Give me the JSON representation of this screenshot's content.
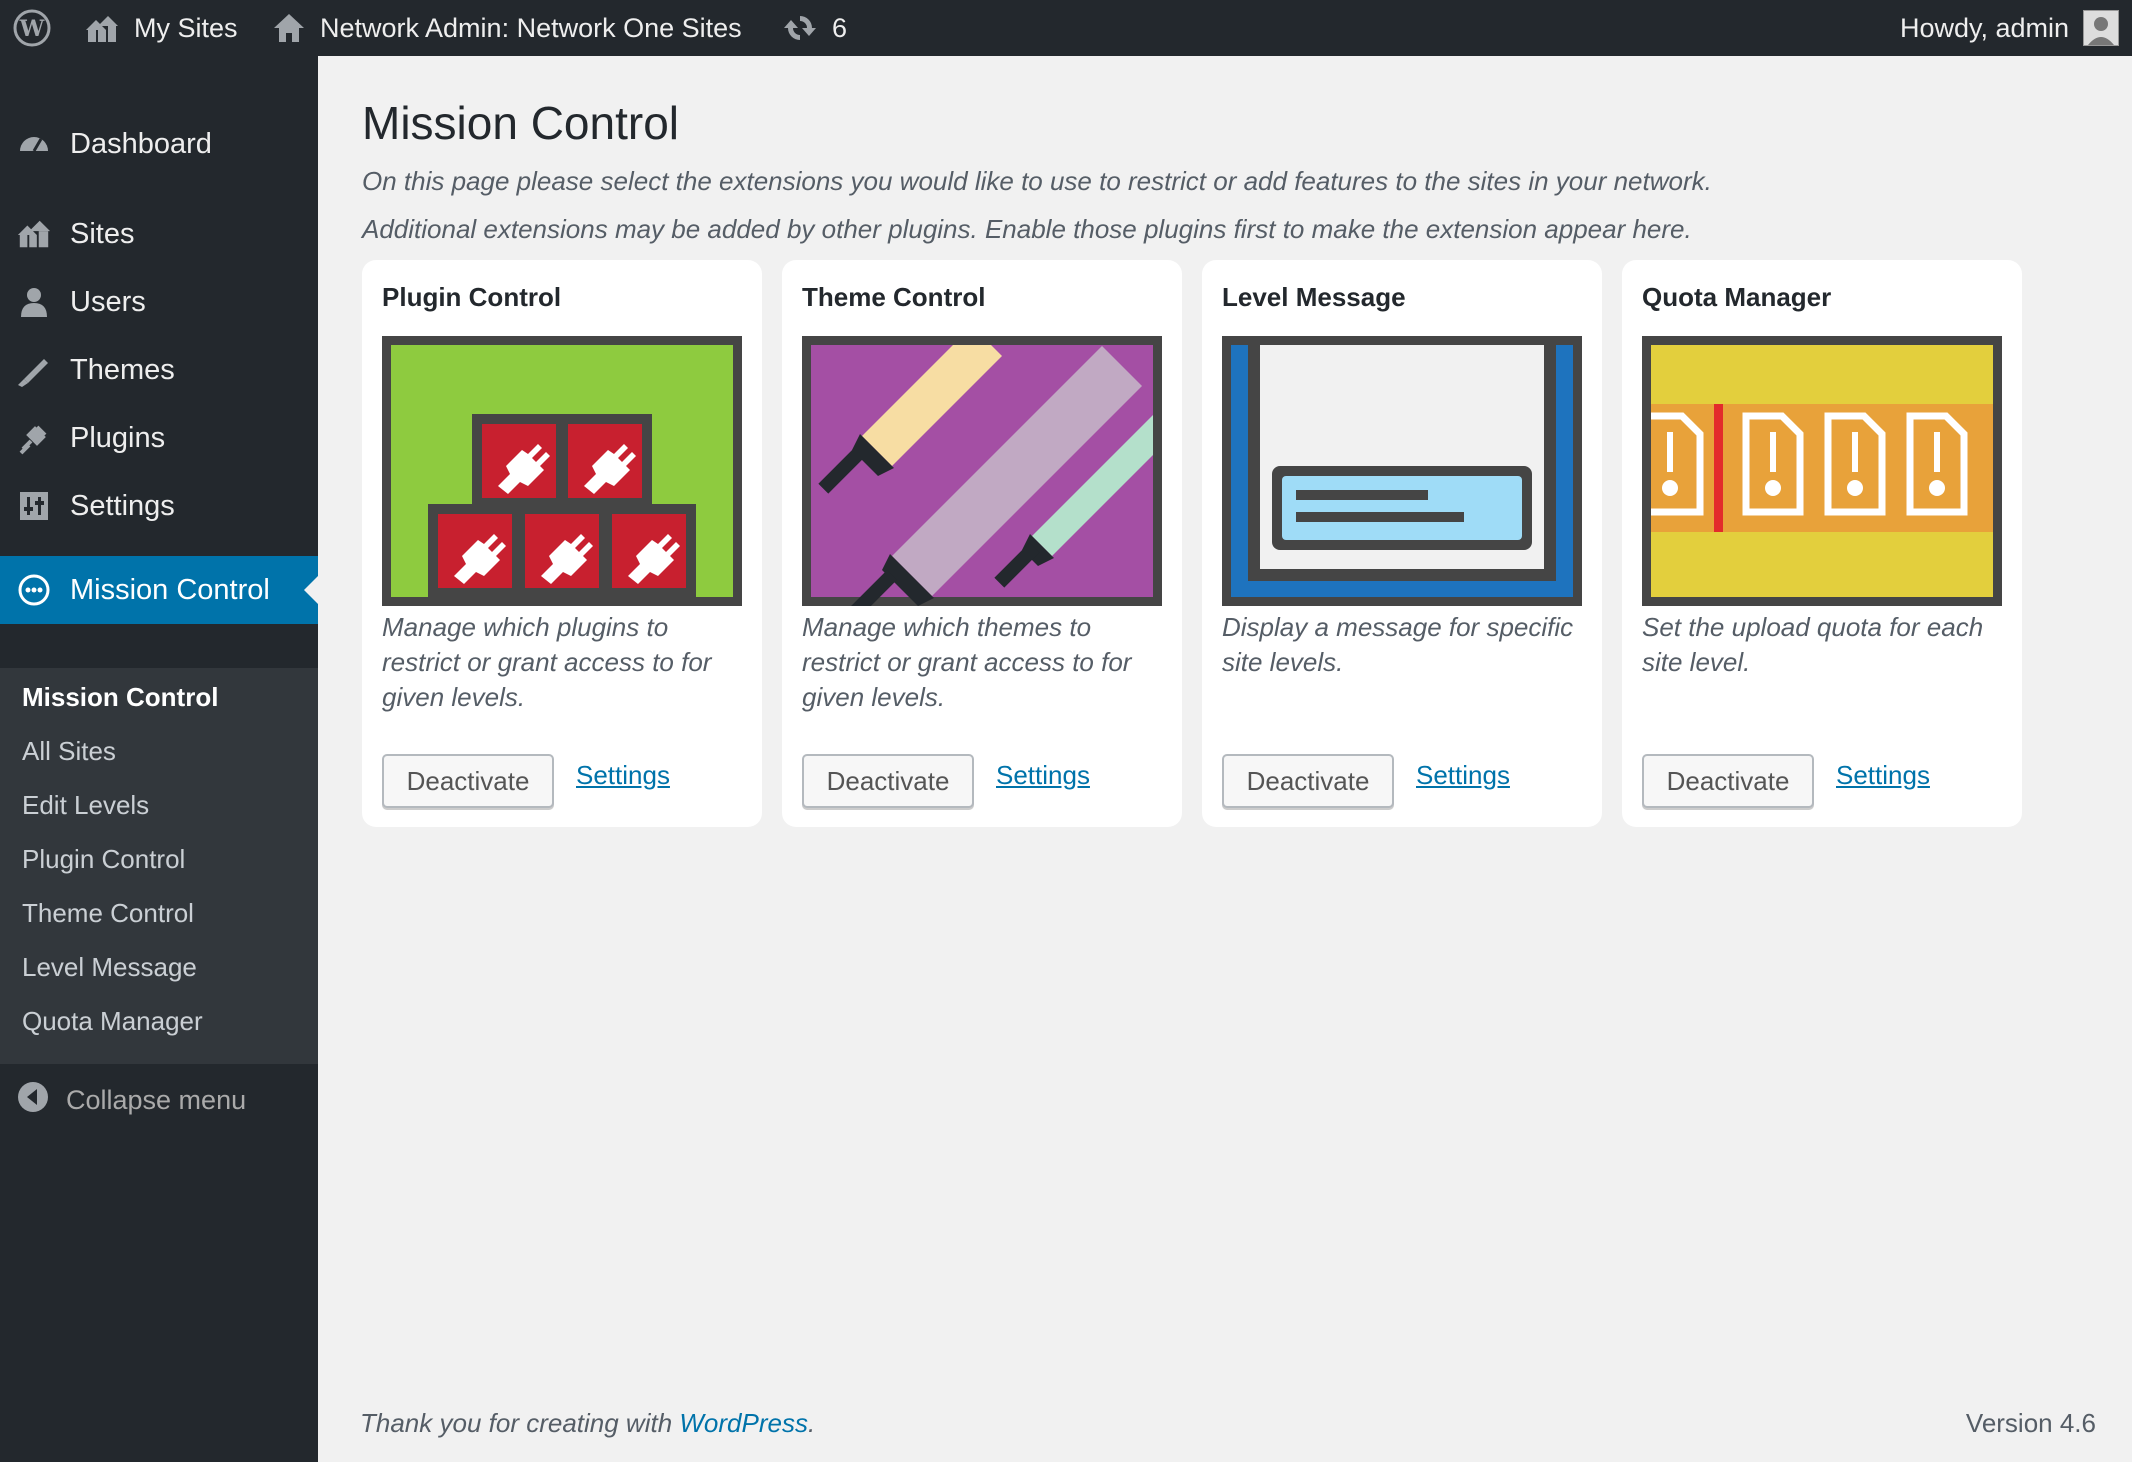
{
  "adminbar": {
    "my_sites": "My Sites",
    "network_admin": "Network Admin: Network One Sites",
    "updates_count": "6",
    "howdy": "Howdy, admin"
  },
  "sidebar": {
    "items": [
      {
        "label": "Dashboard",
        "icon": "dashboard-icon"
      },
      {
        "label": "Sites",
        "icon": "sites-icon"
      },
      {
        "label": "Users",
        "icon": "users-icon"
      },
      {
        "label": "Themes",
        "icon": "themes-icon"
      },
      {
        "label": "Plugins",
        "icon": "plugins-icon"
      },
      {
        "label": "Settings",
        "icon": "settings-icon"
      },
      {
        "label": "Mission Control",
        "icon": "mission-control-icon"
      }
    ],
    "submenu": [
      "Mission Control",
      "All Sites",
      "Edit Levels",
      "Plugin Control",
      "Theme Control",
      "Level Message",
      "Quota Manager"
    ],
    "collapse": "Collapse menu"
  },
  "page": {
    "title": "Mission Control",
    "desc1": "On this page please select the extensions you would like to use to restrict or add features to the sites in your network.",
    "desc2": "Additional extensions may be added by other plugins. Enable those plugins first to make the extension appear here."
  },
  "cards": [
    {
      "title": "Plugin Control",
      "desc": "Manage which plugins to restrict or grant access to for given levels.",
      "button": "Deactivate",
      "link": "Settings",
      "color": "#8ecb3f"
    },
    {
      "title": "Theme Control",
      "desc": "Manage which themes to restrict or grant access to for given levels.",
      "button": "Deactivate",
      "link": "Settings",
      "color": "#a44fa4"
    },
    {
      "title": "Level Message",
      "desc": "Display a message for specific site levels.",
      "button": "Deactivate",
      "link": "Settings",
      "color": "#1e73be"
    },
    {
      "title": "Quota Manager",
      "desc": "Set the upload quota for each site level.",
      "button": "Deactivate",
      "link": "Settings",
      "color": "#e3cf3d"
    }
  ],
  "footer": {
    "thanks_prefix": "Thank you for creating with ",
    "thanks_link": "WordPress",
    "thanks_suffix": ".",
    "version": "Version 4.6"
  }
}
